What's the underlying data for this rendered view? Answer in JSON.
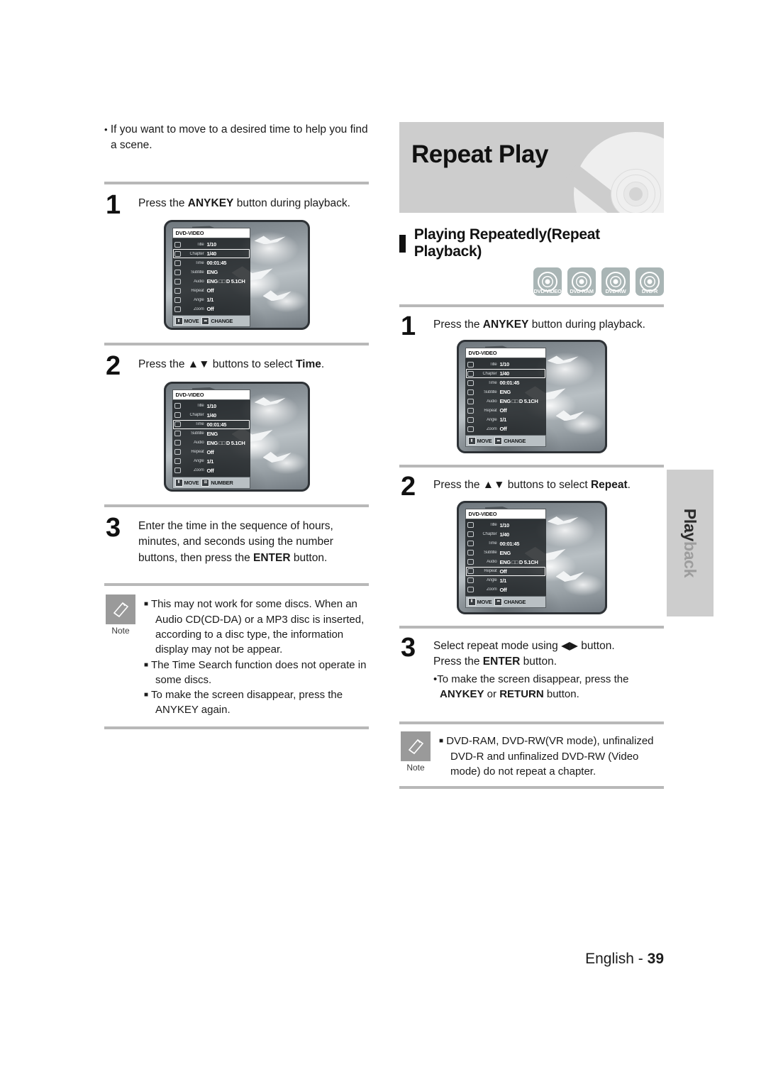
{
  "page": {
    "footer_language": "English - ",
    "footer_number": "39",
    "side_tab_part1": "Play",
    "side_tab_part2": "back"
  },
  "left_column": {
    "intro_bullet": "If you want to move to a desired time to help you find a scene.",
    "steps": [
      {
        "number": "1",
        "text_before": "Press the ",
        "text_bold": "ANYKEY",
        "text_after": " button during playback."
      },
      {
        "number": "2",
        "text_before": "Press the ▲▼ buttons to select ",
        "text_bold": "Time",
        "text_after": "."
      },
      {
        "number": "3",
        "text_before": "Enter the time in the sequence of hours, minutes, and seconds using the number buttons, then press the ",
        "text_bold": "ENTER",
        "text_after": " button."
      }
    ],
    "note": {
      "caption": "Note",
      "icon": "pencil-note-icon",
      "items": [
        "This may not work for some discs. When an Audio CD(CD-DA) or a MP3 disc is inserted, according to a disc type, the information display may not be appear.",
        "The Time Search function does not operate in some discs.",
        "To make the screen disappear, press the ANYKEY again."
      ]
    }
  },
  "right_column": {
    "banner_title": "Repeat Play",
    "section_title": "Playing Repeatedly(Repeat Playback)",
    "disc_badges": [
      {
        "label": "DVD-VIDEO",
        "icon": "disc-icon"
      },
      {
        "label": "DVD-RAM",
        "icon": "disc-icon"
      },
      {
        "label": "DVD-RW",
        "icon": "disc-icon"
      },
      {
        "label": "DVD-R",
        "icon": "disc-icon"
      }
    ],
    "steps": [
      {
        "number": "1",
        "text_before": "Press the ",
        "text_bold": "ANYKEY",
        "text_after": " button during playback."
      },
      {
        "number": "2",
        "text_before": "Press the ▲▼ buttons to select ",
        "text_bold": "Repeat",
        "text_after": "."
      },
      {
        "number": "3",
        "line1_before": "Select repeat mode using ◀▶ button.",
        "line2_before": "Press the ",
        "line2_bold": "ENTER",
        "line2_after": " button.",
        "sub_before": "To make the screen disappear, press the ",
        "sub_bold1": "ANYKEY",
        "sub_mid": " or ",
        "sub_bold2": "RETURN",
        "sub_after": " button."
      }
    ],
    "note": {
      "caption": "Note",
      "icon": "pencil-note-icon",
      "items": [
        "DVD-RAM, DVD-RW(VR mode), unfinalized DVD-R and unfinalized DVD-RW (Video mode) do not repeat a chapter."
      ]
    }
  },
  "osd_screens": {
    "header": "DVD-VIDEO",
    "rows": [
      {
        "label": "Title",
        "value": "1/10",
        "icon": "title-icon"
      },
      {
        "label": "Chapter",
        "value": "1/40",
        "icon": "chapter-icon"
      },
      {
        "label": "Time",
        "value": "00:01:45",
        "icon": "clock-icon"
      },
      {
        "label": "Subtitle",
        "value": "ENG",
        "icon": "subtitle-icon"
      },
      {
        "label": "Audio",
        "value": "ENG □□ D 5.1CH",
        "icon": "speaker-icon"
      },
      {
        "label": "Repeat",
        "value": "Off",
        "icon": "repeat-icon"
      },
      {
        "label": "Angle",
        "value": "1/1",
        "icon": "angle-icon"
      },
      {
        "label": "Zoom",
        "value": "Off",
        "icon": "zoom-icon"
      }
    ],
    "buttons": {
      "move": "MOVE",
      "change": "CHANGE",
      "number": "NUMBER"
    },
    "selected": {
      "left_step1": "Chapter",
      "left_step2": "Time",
      "right_step1": "Chapter",
      "right_step2": "Repeat"
    }
  }
}
